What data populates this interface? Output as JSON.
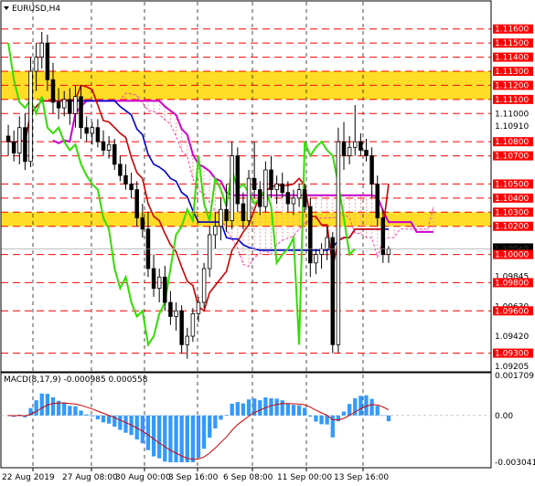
{
  "title": "EURUSD,H4",
  "macd": {
    "label": "MACD(8,17,9) -0.000985 0.000558",
    "axis_labels": [
      "0.001709",
      "0.00",
      "-0.003041"
    ],
    "ylim": [
      -0.003041,
      0.001709
    ]
  },
  "x_tick_labels": [
    "22 Aug 2019",
    "27 Aug 08:00",
    "30 Aug 00:00",
    "3 Sep 16:00",
    "6 Sep 08:00",
    "11 Sep 00:00",
    "13 Sep 16:00"
  ],
  "colors": {
    "up": "#00aa00",
    "down": "#ff0000",
    "zone": "#ffd700",
    "tenkan": "#cc0000",
    "kijun": "#0000cc",
    "chikou": "#33dd00",
    "senkou_a": "#ff44aa",
    "senkou_b": "#cc00cc",
    "macd_hist": "#3399ff",
    "signal": "#cc0000"
  },
  "chart_data": {
    "type": "candlestick",
    "symbol": "EURUSD",
    "timeframe": "H4",
    "ylim": [
      1.092,
      1.1165
    ],
    "price_labels": [
      "1.11600",
      "1.11500",
      "1.11400",
      "1.11300",
      "1.11200",
      "1.11100",
      "1.11000",
      "1.10910",
      "1.10800",
      "1.10700",
      "1.10500",
      "1.10400",
      "1.10300",
      "1.10200",
      "1.10040",
      "1.10000",
      "1.09845",
      "1.09800",
      "1.09630",
      "1.09600",
      "1.09420",
      "1.09300",
      "1.09205"
    ],
    "red_levels": [
      "1.11600",
      "1.11500",
      "1.11400",
      "1.11300",
      "1.11200",
      "1.11100",
      "1.11000",
      "1.10800",
      "1.10700",
      "1.10500",
      "1.10400",
      "1.10300",
      "1.10200",
      "1.10000",
      "1.09800",
      "1.09600",
      "1.09300"
    ],
    "highlight_levels": [
      "1.11600",
      "1.11500",
      "1.11400",
      "1.11300",
      "1.11200",
      "1.11100",
      "1.10800",
      "1.10700",
      "1.10500",
      "1.10400",
      "1.10300",
      "1.10200",
      "1.10000",
      "1.09800",
      "1.09600",
      "1.09300"
    ],
    "current_price": "1.10040",
    "zones": [
      [
        1.111,
        1.113
      ],
      [
        1.102,
        1.103
      ]
    ],
    "candles": [
      [
        1.1084,
        1.1092,
        1.107,
        1.108
      ],
      [
        1.108,
        1.1088,
        1.1066,
        1.1072
      ],
      [
        1.1072,
        1.1098,
        1.1064,
        1.109
      ],
      [
        1.109,
        1.11,
        1.106,
        1.1066
      ],
      [
        1.1066,
        1.114,
        1.1062,
        1.113
      ],
      [
        1.113,
        1.115,
        1.1116,
        1.114
      ],
      [
        1.114,
        1.1158,
        1.1132,
        1.115
      ],
      [
        1.115,
        1.1156,
        1.1116,
        1.1124
      ],
      [
        1.1124,
        1.1136,
        1.11,
        1.1108
      ],
      [
        1.1108,
        1.1118,
        1.1096,
        1.1104
      ],
      [
        1.1104,
        1.1116,
        1.1098,
        1.111
      ],
      [
        1.111,
        1.1118,
        1.1092,
        1.11
      ],
      [
        1.11,
        1.112,
        1.109,
        1.1112
      ],
      [
        1.1112,
        1.112,
        1.1082,
        1.109
      ],
      [
        1.109,
        1.1098,
        1.108,
        1.1086
      ],
      [
        1.1086,
        1.1094,
        1.1078,
        1.109
      ],
      [
        1.109,
        1.1096,
        1.1076,
        1.108
      ],
      [
        1.108,
        1.1088,
        1.107,
        1.1074
      ],
      [
        1.1074,
        1.1084,
        1.1068,
        1.1078
      ],
      [
        1.1078,
        1.1082,
        1.106,
        1.1064
      ],
      [
        1.1064,
        1.107,
        1.1052,
        1.1056
      ],
      [
        1.1056,
        1.1064,
        1.1046,
        1.105
      ],
      [
        1.105,
        1.1058,
        1.104,
        1.1046
      ],
      [
        1.1046,
        1.1052,
        1.102,
        1.1026
      ],
      [
        1.1026,
        1.1036,
        1.1012,
        1.1018
      ],
      [
        1.1018,
        1.103,
        1.0984,
        1.099
      ],
      [
        1.099,
        1.1,
        1.097,
        1.0976
      ],
      [
        1.0976,
        1.099,
        1.0966,
        1.0984
      ],
      [
        1.0984,
        1.0992,
        1.096,
        1.0966
      ],
      [
        1.0966,
        1.0974,
        1.095,
        1.0956
      ],
      [
        1.0956,
        1.0966,
        1.0946,
        1.096
      ],
      [
        1.096,
        1.0964,
        1.093,
        1.0936
      ],
      [
        1.0936,
        1.0948,
        1.0926,
        1.0942
      ],
      [
        1.0942,
        1.0962,
        1.0938,
        1.0958
      ],
      [
        1.0958,
        1.097,
        1.0952,
        1.0966
      ],
      [
        1.0966,
        1.0994,
        1.0962,
        1.099
      ],
      [
        1.099,
        1.102,
        1.0984,
        1.1014
      ],
      [
        1.1014,
        1.103,
        1.1004,
        1.102
      ],
      [
        1.102,
        1.104,
        1.101,
        1.1032
      ],
      [
        1.1032,
        1.105,
        1.1016,
        1.1024
      ],
      [
        1.1024,
        1.108,
        1.1018,
        1.107
      ],
      [
        1.107,
        1.1076,
        1.103,
        1.1036
      ],
      [
        1.1036,
        1.1044,
        1.1018,
        1.1024
      ],
      [
        1.1024,
        1.106,
        1.102,
        1.1054
      ],
      [
        1.1054,
        1.108,
        1.104,
        1.1046
      ],
      [
        1.1046,
        1.1052,
        1.1028,
        1.1034
      ],
      [
        1.1034,
        1.1066,
        1.103,
        1.106
      ],
      [
        1.106,
        1.107,
        1.104,
        1.1046
      ],
      [
        1.1046,
        1.1056,
        1.1036,
        1.105
      ],
      [
        1.105,
        1.1058,
        1.104,
        1.1044
      ],
      [
        1.1044,
        1.1052,
        1.103,
        1.1036
      ],
      [
        1.1036,
        1.1046,
        1.1028,
        1.104
      ],
      [
        1.104,
        1.105,
        1.1034,
        1.1046
      ],
      [
        1.1046,
        1.105,
        1.103,
        1.1034
      ],
      [
        1.1034,
        1.104,
        1.0984,
        1.0994
      ],
      [
        1.0994,
        1.1004,
        1.0986,
        1.1
      ],
      [
        1.1,
        1.1008,
        1.099,
        1.1004
      ],
      [
        1.1004,
        1.102,
        1.0996,
        1.1012
      ],
      [
        1.1012,
        1.1016,
        1.093,
        1.0936
      ],
      [
        1.0936,
        1.109,
        1.093,
        1.108
      ],
      [
        1.108,
        1.1094,
        1.106,
        1.107
      ],
      [
        1.107,
        1.1084,
        1.1064,
        1.1076
      ],
      [
        1.1076,
        1.1106,
        1.107,
        1.108
      ],
      [
        1.108,
        1.1086,
        1.107,
        1.1074
      ],
      [
        1.1074,
        1.1082,
        1.1066,
        1.107
      ],
      [
        1.107,
        1.1076,
        1.104,
        1.105
      ],
      [
        1.105,
        1.1056,
        1.102,
        1.1026
      ],
      [
        1.1026,
        1.1032,
        1.0994,
        1.1
      ],
      [
        1.1,
        1.1006,
        1.0994,
        1.1004
      ]
    ]
  }
}
